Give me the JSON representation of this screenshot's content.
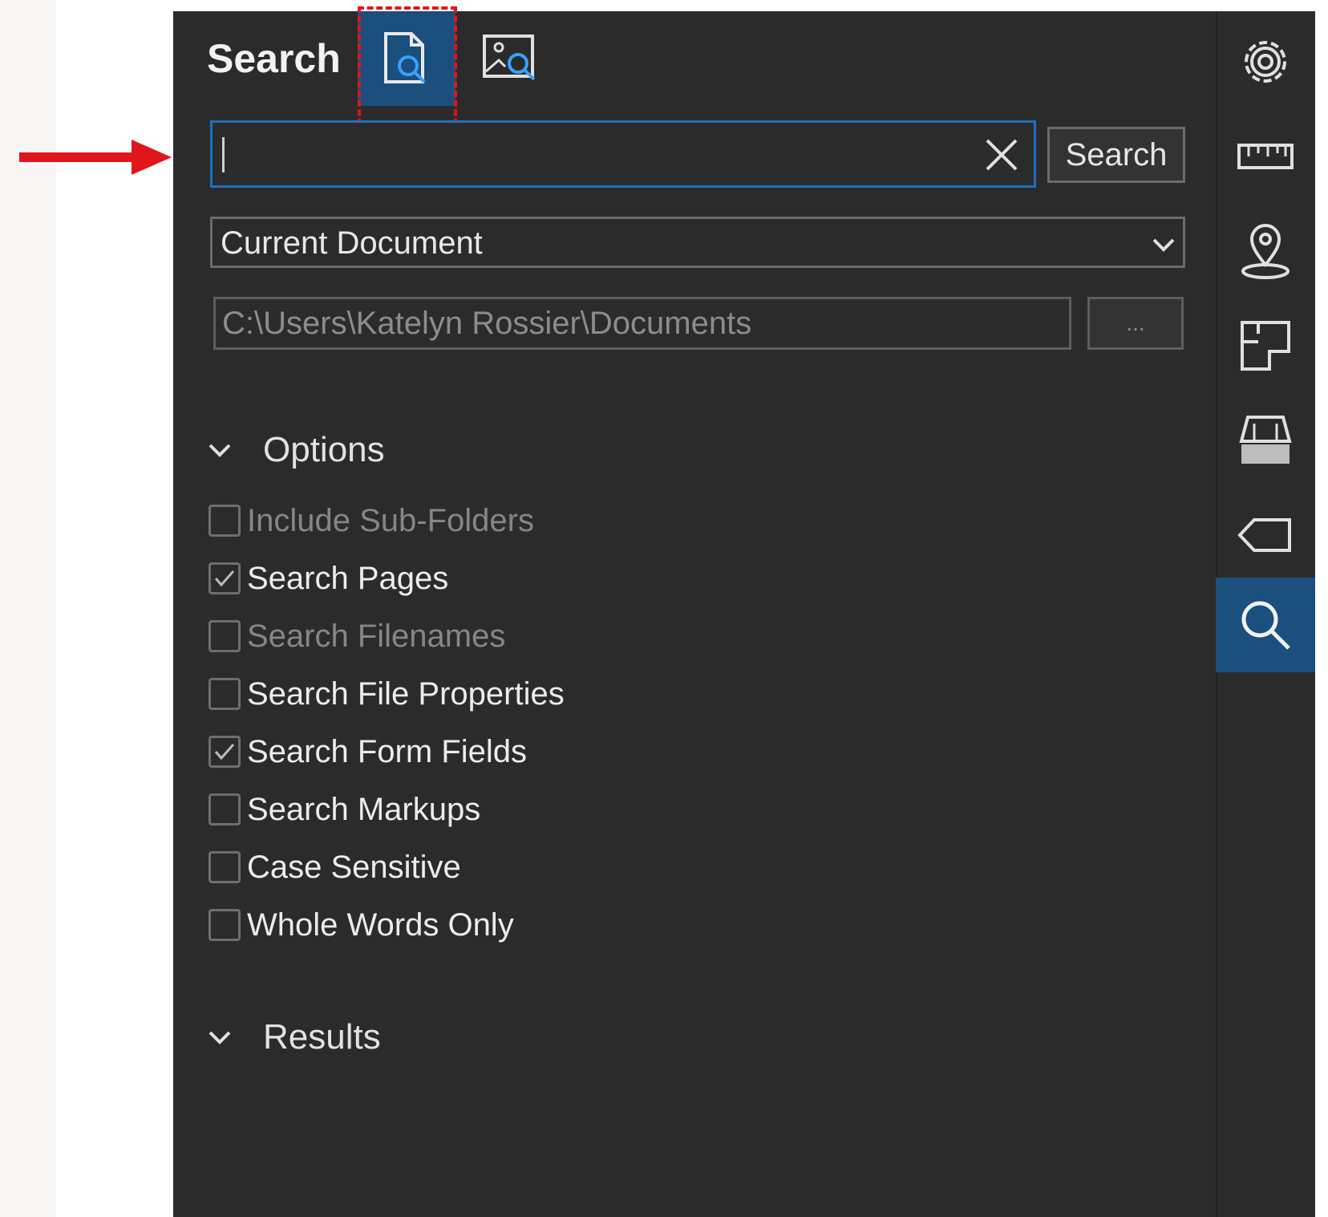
{
  "panel": {
    "title": "Search"
  },
  "tabs": [
    {
      "name": "text-search-tab",
      "icon": "document-search-icon",
      "active": true
    },
    {
      "name": "image-search-tab",
      "icon": "image-search-icon",
      "active": false
    }
  ],
  "search": {
    "value": "",
    "button_label": "Search"
  },
  "scope": {
    "selected": "Current Document"
  },
  "folder": {
    "path": "C:\\Users\\Katelyn Rossier\\Documents",
    "browse_label": "..."
  },
  "options": {
    "header": "Options",
    "items": [
      {
        "label": "Include Sub-Folders",
        "checked": false,
        "enabled": false
      },
      {
        "label": "Search Pages",
        "checked": true,
        "enabled": true
      },
      {
        "label": "Search Filenames",
        "checked": false,
        "enabled": false
      },
      {
        "label": "Search File Properties",
        "checked": false,
        "enabled": true
      },
      {
        "label": "Search Form Fields",
        "checked": true,
        "enabled": true
      },
      {
        "label": "Search Markups",
        "checked": false,
        "enabled": true
      },
      {
        "label": "Case Sensitive",
        "checked": false,
        "enabled": true
      },
      {
        "label": "Whole Words Only",
        "checked": false,
        "enabled": true
      }
    ]
  },
  "results": {
    "header": "Results"
  },
  "rail": {
    "icons": [
      "gear-icon",
      "ruler-icon",
      "location-pin-icon",
      "layout-icon",
      "stamp-icon",
      "tag-icon",
      "search-icon"
    ],
    "active": "search-icon"
  },
  "colors": {
    "panel_bg": "#2b2b2b",
    "accent": "#1a4f7e",
    "focus_border": "#1f6fbd",
    "annotation_red": "#e0161c"
  }
}
